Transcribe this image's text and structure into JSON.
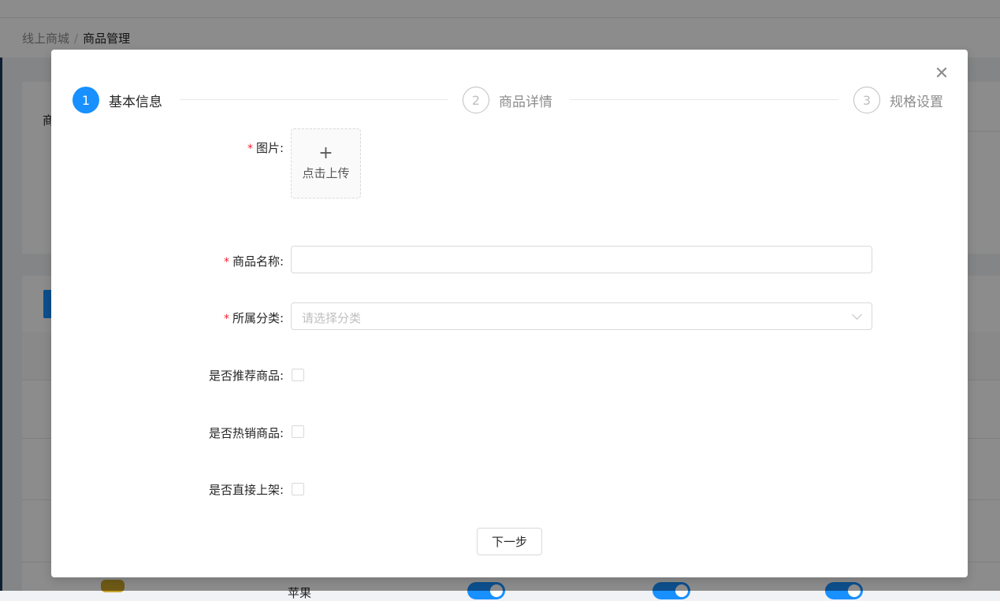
{
  "background": {
    "breadcrumb": {
      "root": "线上商城",
      "separator": "/",
      "current": "商品管理"
    },
    "search_label_partial": "商",
    "table_row_text_partial": "苹果"
  },
  "modal": {
    "steps": [
      {
        "number": "1",
        "title": "基本信息",
        "status": "active"
      },
      {
        "number": "2",
        "title": "商品详情",
        "status": "wait"
      },
      {
        "number": "3",
        "title": "规格设置",
        "status": "wait"
      }
    ],
    "form": {
      "image_label": "图片:",
      "upload_plus": "+",
      "upload_text": "点击上传",
      "name_label": "商品名称:",
      "name_value": "",
      "category_label": "所属分类:",
      "category_placeholder": "请选择分类",
      "recommend_label": "是否推荐商品:",
      "recommend_checked": false,
      "hot_label": "是否热销商品:",
      "hot_checked": false,
      "shelf_label": "是否直接上架:",
      "shelf_checked": false,
      "required_mark": "*"
    },
    "next_button": "下一步",
    "close_glyph": "✕"
  },
  "colors": {
    "primary": "#1890ff",
    "required": "#f5222d",
    "border": "#d9d9d9"
  }
}
